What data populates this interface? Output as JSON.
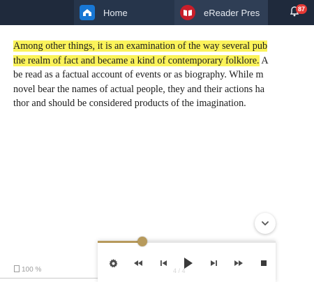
{
  "taskbar": {
    "tabs": [
      {
        "label": "Home",
        "icon": "home-icon"
      },
      {
        "label": "eReader Pres",
        "icon": "ereader-icon"
      }
    ],
    "notification_count": "87"
  },
  "reader": {
    "lines": [
      {
        "text": "Among other things, it is an examination of the way several pub",
        "highlighted": true
      },
      {
        "text": "the realm of fact and became a kind of contemporary folklore.",
        "highlighted": true,
        "tail": " A"
      },
      {
        "text": "be read as a factual account of events or as biography. While m",
        "highlighted": false
      },
      {
        "text": "novel bear the names of actual people, they and their actions ha",
        "highlighted": false
      },
      {
        "text": "thor and should be considered products of the imagination.",
        "highlighted": false
      }
    ],
    "highlight_color": "#fbf35a"
  },
  "footer": {
    "zoom": "100 %"
  },
  "player": {
    "position_text": "4 / 4",
    "progress": 0.25,
    "accent_color": "#b79a5c",
    "controls": [
      "settings-icon",
      "rewind-icon",
      "previous-icon",
      "play-icon",
      "next-icon",
      "fast-forward-icon",
      "stop-icon"
    ]
  }
}
